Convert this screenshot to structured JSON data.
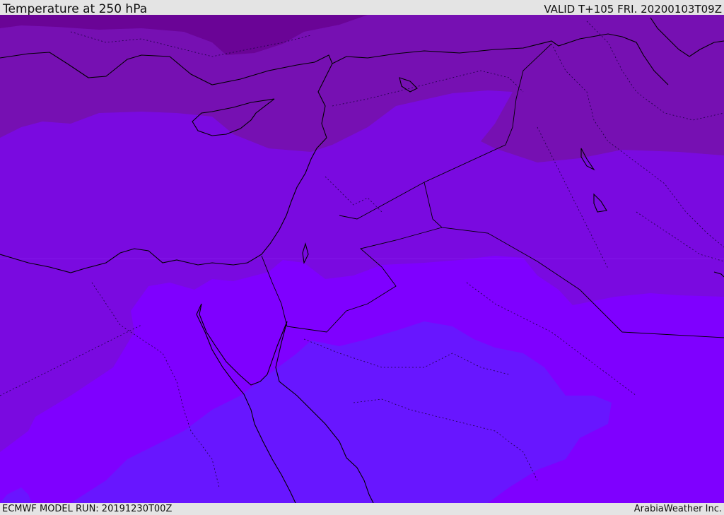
{
  "header": {
    "title": "Temperature at 250 hPa",
    "valid": "VALID T+105 FRI. 20200103T09Z"
  },
  "footer": {
    "model_run": "ECMWF MODEL RUN: 20191230T00Z",
    "credit": "ArabiaWeather Inc."
  },
  "map": {
    "field_colors": [
      "#6a0496",
      "#7710b0",
      "#7b04dc",
      "#7f00ff",
      "#6714ff"
    ],
    "coastline_color": "#000000",
    "border_style": "dotted"
  }
}
